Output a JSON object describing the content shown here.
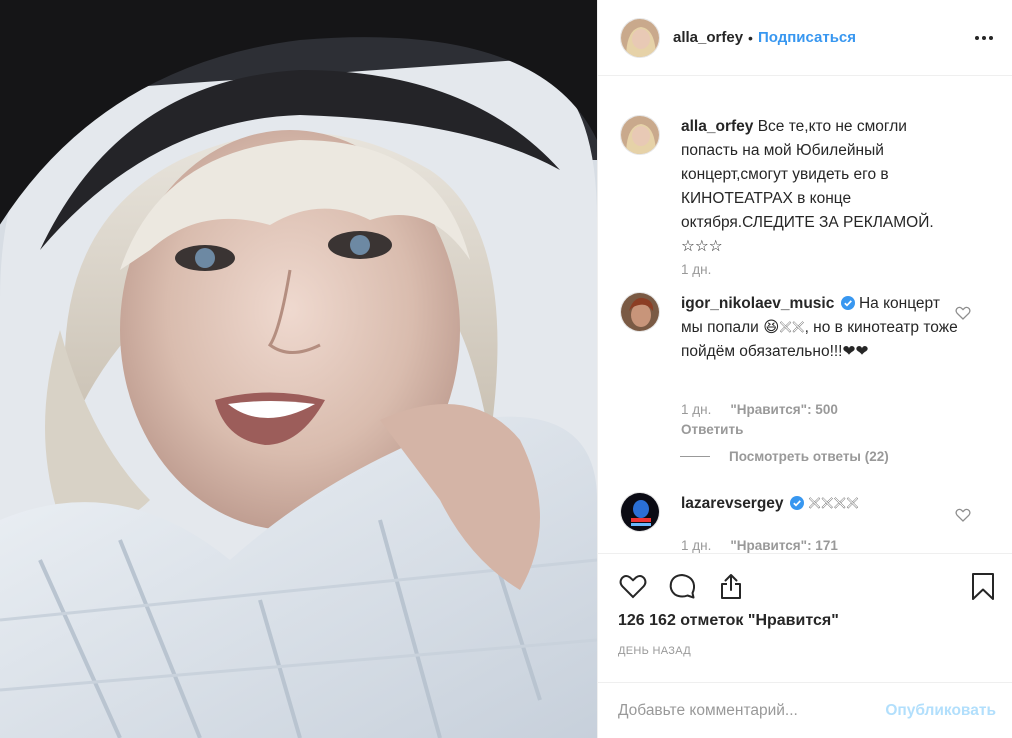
{
  "post": {
    "username": "alla_orfey",
    "follow_label": "Подписаться",
    "separator": "•",
    "photo_alt": "",
    "caption": {
      "username": "alla_orfey",
      "text": "Все те,кто не смогли попасть на мой Юбилейный концерт,смогут увидеть его в КИНОТЕАТРАХ в конце октября.СЛЕДИТЕ ЗА РЕКЛАМОЙ. ☆☆☆",
      "time": "1 дн."
    },
    "comments": [
      {
        "username": "igor_nikolaev_music",
        "verified": true,
        "text": "На концерт мы попали 😆𓏴𓏴, но в кинотеатр тоже пойдём обязательно!!!❤❤",
        "time": "1 дн.",
        "likes": "\"Нравится\": 500",
        "reply_label": "Ответить",
        "view_replies": "Посмотреть ответы (22)"
      },
      {
        "username": "lazarevsergey",
        "verified": true,
        "text": "𓏴𓏴𓏴𓏴",
        "time": "1 дн.",
        "likes": "\"Нравится\": 171"
      }
    ],
    "likes_count": "126 162 отметок \"Нравится\"",
    "date": "ДЕНЬ НАЗАД",
    "comment_placeholder": "Добавьте комментарий...",
    "publish_label": "Опубликовать"
  },
  "icons": {
    "like": "heart-icon",
    "comment": "comment-icon",
    "share": "share-icon",
    "save": "bookmark-icon",
    "more": "more-options-icon",
    "verified": "verified-badge-icon"
  },
  "colors": {
    "accent": "#3897f0",
    "publish_disabled": "#b2dffc",
    "heart_red": "#ed4956",
    "text_muted": "#999999"
  }
}
